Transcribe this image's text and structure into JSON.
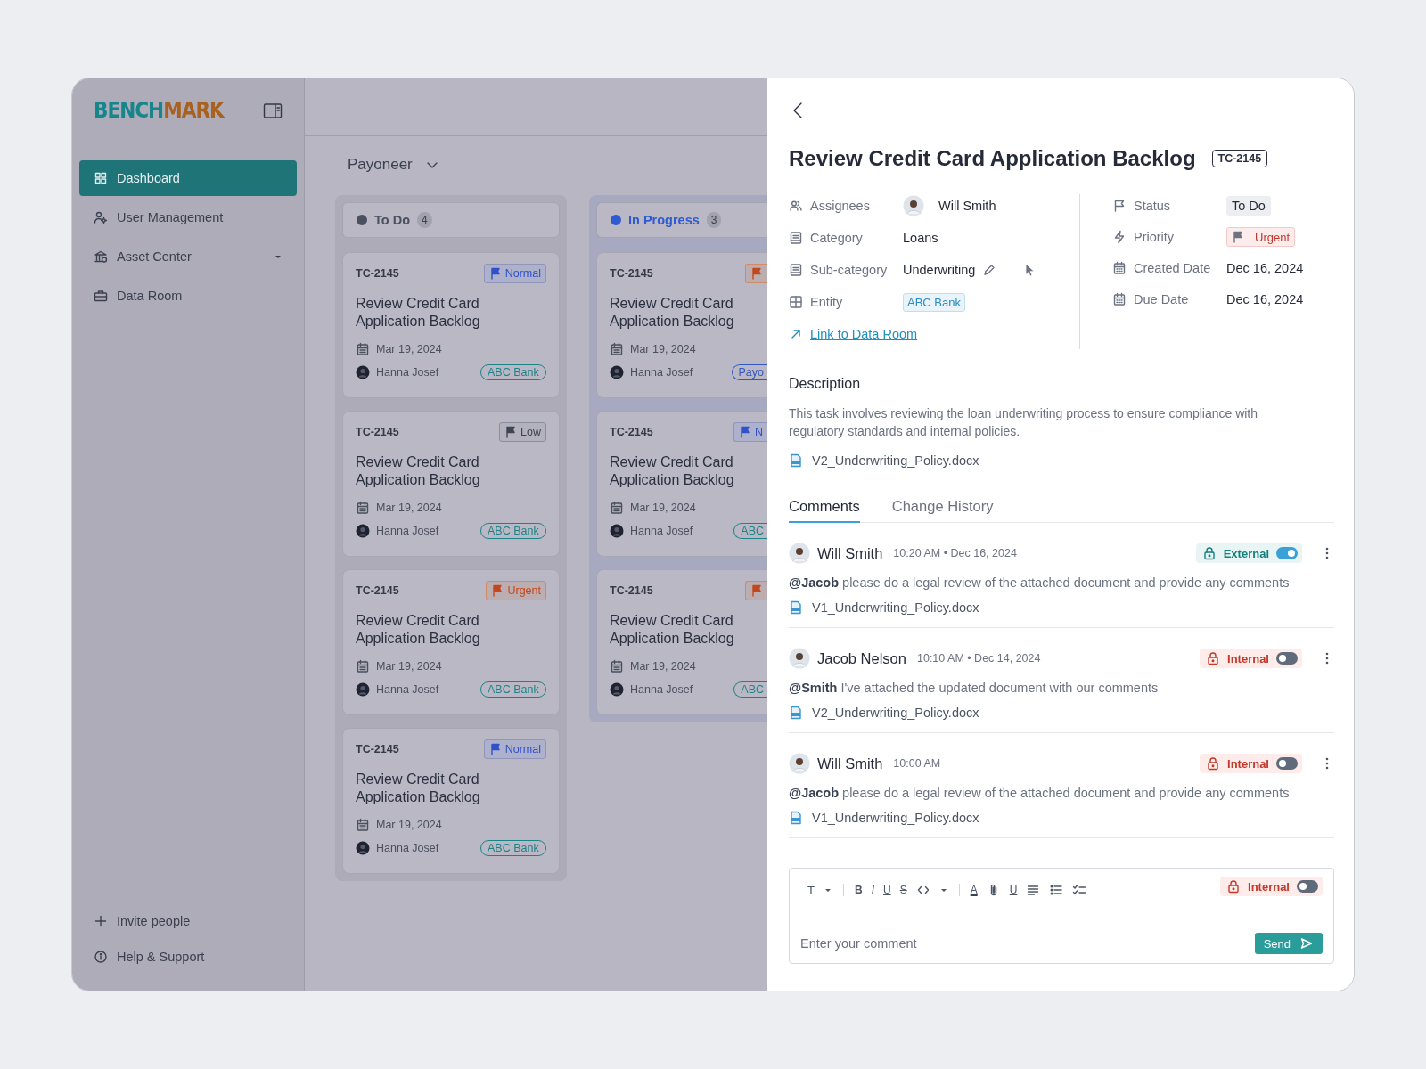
{
  "sidebar": {
    "logo": "BENCHMARK",
    "nav": [
      {
        "label": "Dashboard",
        "kind": "link",
        "selected": true
      },
      {
        "label": "User Management",
        "kind": "link",
        "selected": false
      },
      {
        "label": "Asset Center",
        "kind": "group",
        "selected": false
      },
      {
        "label": "Data Room",
        "kind": "link",
        "selected": false
      }
    ],
    "footer": [
      "Invite people",
      "Help & Support"
    ]
  },
  "board": {
    "workspace": "Payoneer",
    "columns": [
      {
        "title": "To Do",
        "count": "4",
        "color": "#4b5060",
        "cards": [
          {
            "id": "TC-2145",
            "priority": {
              "kind": "normal",
              "label": "Normal"
            },
            "title": "Review Credit Card Application Backlog",
            "date": "Mar 19, 2024",
            "assignee": "Hanna Josef",
            "tag": {
              "label": "ABC Bank",
              "color": "#1e8388"
            }
          },
          {
            "id": "TC-2145",
            "priority": {
              "kind": "low",
              "label": "Low"
            },
            "title": "Review Credit Card Application Backlog",
            "date": "Mar 19, 2024",
            "assignee": "Hanna Josef",
            "tag": {
              "label": "ABC Bank",
              "color": "#1e8388"
            }
          },
          {
            "id": "TC-2145",
            "priority": {
              "kind": "urgent",
              "label": "Urgent"
            },
            "title": "Review Credit Card Application Backlog",
            "date": "Mar 19, 2024",
            "assignee": "Hanna Josef",
            "tag": {
              "label": "ABC Bank",
              "color": "#1e8388"
            }
          },
          {
            "id": "TC-2145",
            "priority": {
              "kind": "normal",
              "label": "Normal"
            },
            "title": "Review Credit Card Application Backlog",
            "date": "Mar 19, 2024",
            "assignee": "Hanna Josef",
            "tag": {
              "label": "ABC Bank",
              "color": "#1e8388"
            }
          }
        ]
      },
      {
        "title": "In Progress",
        "count": "3",
        "color": "#2f5bd0",
        "cards": [
          {
            "id": "TC-2145",
            "priority": {
              "kind": "urgent"
            },
            "title": "Review Credit Card Application Backlog",
            "date": "Mar 19, 2024",
            "assignee": "Hanna Josef",
            "tag": {
              "label": "Payo",
              "color": "#3358c4"
            }
          },
          {
            "id": "TC-2145",
            "priority": {
              "kind": "normal",
              "label": "N"
            },
            "title": "Review Credit Card Application Backlog",
            "date": "Mar 19, 2024",
            "assignee": "Hanna Josef",
            "tag": {
              "label": "ABC",
              "color": "#1e8388"
            }
          },
          {
            "id": "TC-2145",
            "priority": {
              "kind": "urgent"
            },
            "title": "Review Credit Card Application Backlog",
            "date": "Mar 19, 2024",
            "assignee": "Hanna Josef",
            "tag": {
              "label": "ABC",
              "color": "#1e8388"
            }
          }
        ]
      }
    ]
  },
  "detail": {
    "title": "Review Credit Card Application Backlog",
    "id": "TC-2145",
    "fields": [
      {
        "label": "Assignees",
        "kind": "person",
        "value": "Will Smith"
      },
      {
        "label": "Category",
        "kind": "text",
        "value": "Loans"
      },
      {
        "label": "Sub-category",
        "kind": "editable",
        "value": "Underwriting"
      },
      {
        "label": "Entity",
        "kind": "tag",
        "value": "ABC Bank"
      }
    ],
    "link": "Link to Data Room",
    "side_fields": [
      {
        "label": "Status",
        "kind": "status",
        "value": "To Do"
      },
      {
        "label": "Priority",
        "kind": "priority",
        "value": "Urgent"
      },
      {
        "label": "Created Date",
        "kind": "text",
        "value": "Dec 16, 2024"
      },
      {
        "label": "Due Date",
        "kind": "text",
        "value": "Dec 16, 2024"
      }
    ],
    "description": {
      "heading": "Description",
      "text": "This task involves reviewing the loan underwriting process to ensure compliance with regulatory standards and internal policies.",
      "file": "V2_Underwriting_Policy.docx"
    },
    "tabs": [
      {
        "label": "Comments",
        "selected": true
      },
      {
        "label": "Change History",
        "selected": false
      }
    ],
    "comments": [
      {
        "author": "Will Smith",
        "time": "10:20 AM • Dec 16, 2024",
        "visibility": {
          "kind": "external",
          "label": "External",
          "on": true
        },
        "text": "**@Jacob** please do a legal review of the attached document and provide any comments",
        "file": "V1_Underwriting_Policy.docx"
      },
      {
        "author": "Jacob Nelson",
        "time": "10:10 AM • Dec 14, 2024",
        "visibility": {
          "kind": "internal",
          "label": "Internal",
          "on": false
        },
        "text": "**@Smith** I've attached the updated document with our comments",
        "file": "V2_Underwriting_Policy.docx"
      },
      {
        "author": "Will Smith",
        "time": "10:00 AM",
        "visibility": {
          "kind": "internal",
          "label": "Internal",
          "on": false
        },
        "text": "**@Jacob** please do a legal review of the attached document and provide any comments",
        "file": "V1_Underwriting_Policy.docx"
      }
    ],
    "editor": {
      "toolbar": [
        {
          "kind": "heading",
          "label": "T"
        },
        {
          "kind": "sep"
        },
        {
          "kind": "bold",
          "label": "B"
        },
        {
          "kind": "italic",
          "label": "I"
        },
        {
          "kind": "underline",
          "label": "U"
        },
        {
          "kind": "strike",
          "label": "S"
        },
        {
          "kind": "code"
        },
        {
          "kind": "more"
        },
        {
          "kind": "sep"
        },
        {
          "kind": "color",
          "label": "A"
        },
        {
          "kind": "attach"
        },
        {
          "kind": "underline",
          "label": "U"
        },
        {
          "kind": "align"
        },
        {
          "kind": "list"
        },
        {
          "kind": "checklist"
        }
      ],
      "visibility": {
        "kind": "internal",
        "label": "Internal",
        "on": false
      },
      "placeholder": "Enter your comment",
      "send": "Send"
    }
  }
}
